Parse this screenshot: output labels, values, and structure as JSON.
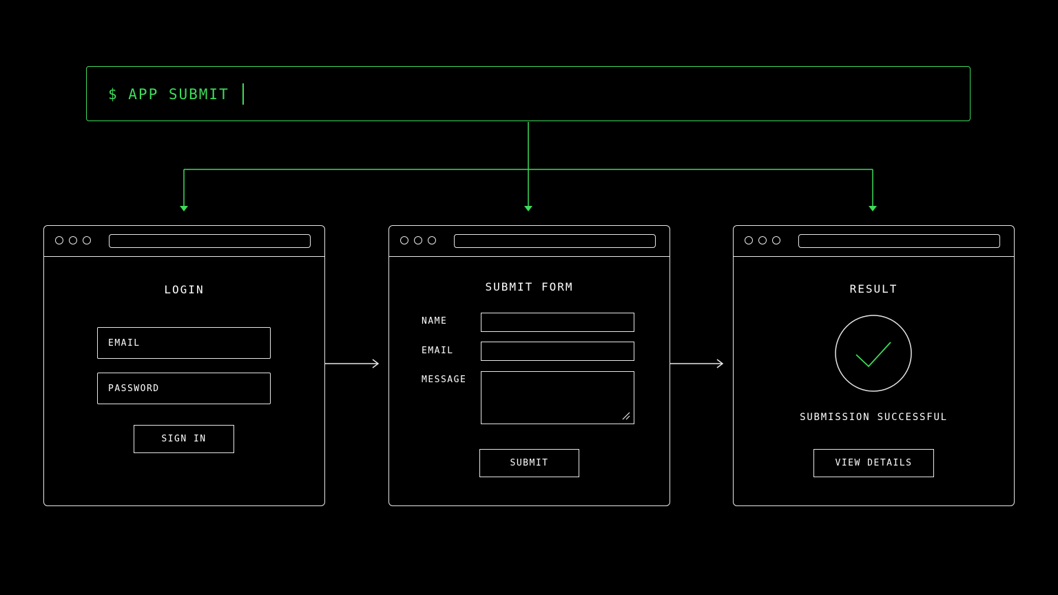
{
  "terminal": {
    "command": "$ APP SUBMIT"
  },
  "colors": {
    "accent": "#3ddc5a",
    "line": "#e8e8e8",
    "background": "#000000"
  },
  "windows": {
    "login": {
      "title": "LOGIN",
      "email_placeholder": "EMAIL",
      "password_placeholder": "PASSWORD",
      "sign_in_label": "SIGN IN"
    },
    "submit_form": {
      "title": "SUBMIT FORM",
      "name_label": "NAME",
      "email_label": "EMAIL",
      "message_label": "MESSAGE",
      "submit_label": "SUBMIT"
    },
    "result": {
      "title": "RESULT",
      "status_icon": "checkmark-circle-icon",
      "status_text": "SUBMISSION SUCCESSFUL",
      "details_label": "VIEW DETAILS"
    }
  }
}
